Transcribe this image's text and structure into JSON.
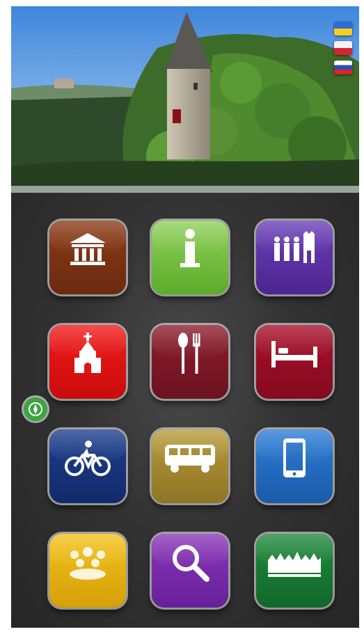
{
  "hero": {
    "flags": [
      {
        "name": "ukrainian",
        "colors": [
          "#2f6ad6",
          "#f3cf24"
        ]
      },
      {
        "name": "polish",
        "colors": [
          "#f2f2f2",
          "#d3252f"
        ]
      },
      {
        "name": "russian",
        "colors": [
          "#ffffff",
          "#2a4fb4",
          "#d8242c"
        ]
      }
    ]
  },
  "menu": {
    "tiles": [
      {
        "id": "museums",
        "icon": "museum-icon",
        "label": "",
        "color": "#7a3213"
      },
      {
        "id": "info",
        "icon": "info-icon",
        "label": "",
        "color": "#74bf42"
      },
      {
        "id": "excursions",
        "icon": "people-tower-icon",
        "label": "",
        "color": "#5b31a3"
      },
      {
        "id": "sacral",
        "icon": "church-icon",
        "label": "",
        "color": "#e31414"
      },
      {
        "id": "restaurants",
        "icon": "cutlery-icon",
        "label": "",
        "color": "#7c1826"
      },
      {
        "id": "hotels",
        "icon": "bed-icon",
        "label": "",
        "color": "#971028"
      },
      {
        "id": "active-rest",
        "icon": "bicycle-icon",
        "label": "",
        "color": "#173580"
      },
      {
        "id": "transport",
        "icon": "bus-icon",
        "label": "",
        "color": "#a48730"
      },
      {
        "id": "mobile",
        "icon": "smartphone-icon",
        "label": "",
        "color": "#236cc0"
      },
      {
        "id": "events",
        "icon": "crowd-icon",
        "label": "",
        "color": "#e6b011"
      },
      {
        "id": "search",
        "icon": "magnifier-icon",
        "label": "",
        "color": "#7a2aaa"
      },
      {
        "id": "nature",
        "icon": "forest-icon",
        "label": "",
        "color": "#187a33"
      }
    ]
  },
  "fab": {
    "icon": "compass-icon",
    "color": "#3fa33f"
  }
}
